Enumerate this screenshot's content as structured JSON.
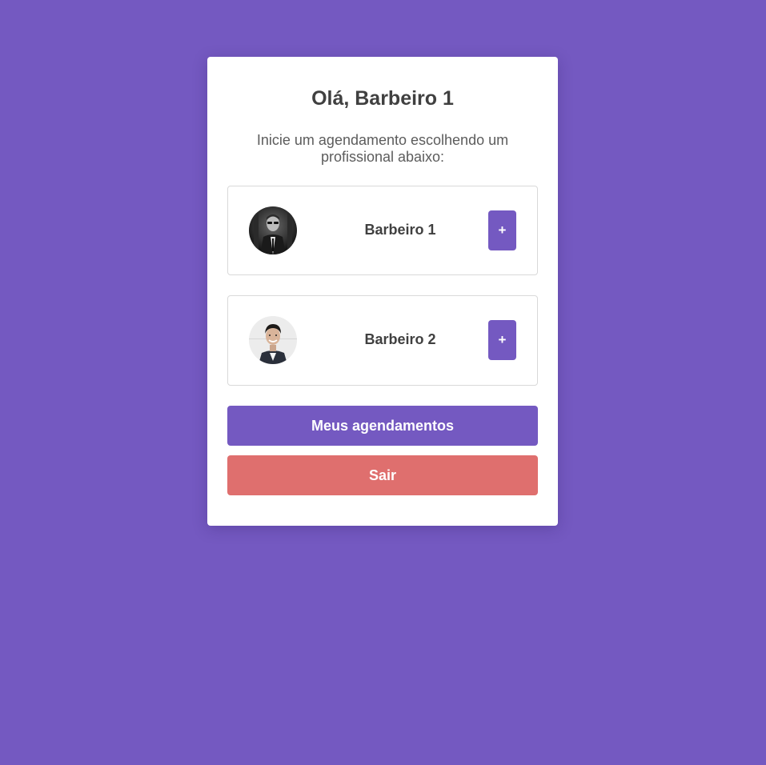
{
  "header": {
    "title": "Olá, Barbeiro 1",
    "subtitle": "Inicie um agendamento escolhendo um profissional abaixo:"
  },
  "barbers": [
    {
      "name": "Barbeiro 1",
      "avatar": "photo-man-suit-sunglasses",
      "add_label": "+"
    },
    {
      "name": "Barbeiro 2",
      "avatar": "photo-man-smiling",
      "add_label": "+"
    }
  ],
  "actions": {
    "appointments_label": "Meus agendamentos",
    "logout_label": "Sair"
  },
  "colors": {
    "background": "#7459c1",
    "primary": "#7459c1",
    "danger": "#df6f6e",
    "card": "#ffffff",
    "text": "#404040"
  }
}
